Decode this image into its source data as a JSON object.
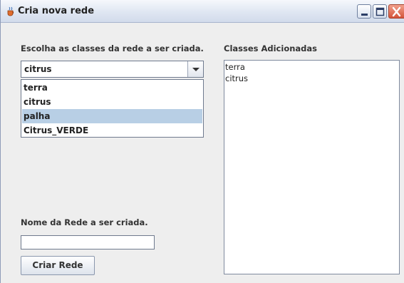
{
  "window": {
    "title": "Cria nova rede"
  },
  "colors": {
    "titlebar": "#dfe6f2",
    "selection": "#b8cfe5",
    "close_button": "#d4543a"
  },
  "icons": {
    "app": "java-cup-icon",
    "minimize": "minimize-icon",
    "maximize": "maximize-icon",
    "close": "close-icon",
    "dropdown": "chevron-down-icon"
  },
  "left_panel": {
    "classes_label": "Escolha as classes da rede a ser criada.",
    "combo_value": "citrus",
    "options": [
      "terra",
      "citrus",
      "palha",
      "Citrus_VERDE"
    ],
    "highlighted_option": "palha",
    "network_name_label": "Nome da Rede a ser criada.",
    "network_name_value": "",
    "create_button": "Criar Rede"
  },
  "right_panel": {
    "added_label": "Classes Adicionadas",
    "added_items": [
      "terra",
      "citrus"
    ]
  }
}
